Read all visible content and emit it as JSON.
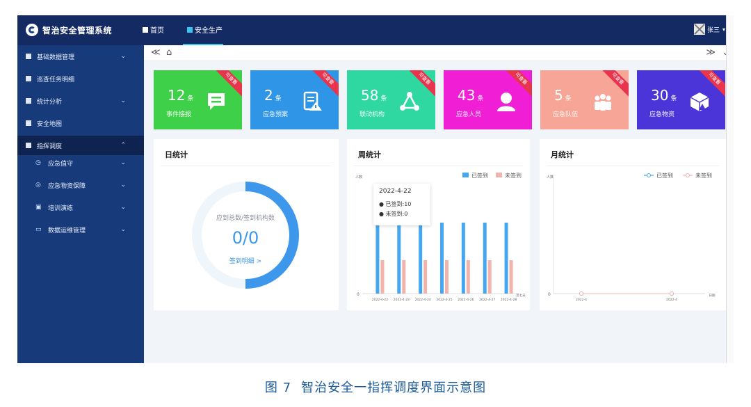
{
  "topbar": {
    "app_title": "智治安全管理系统",
    "tabs": [
      {
        "label": "首页"
      },
      {
        "label": "安全生产"
      }
    ],
    "user": "张三"
  },
  "sidebar": {
    "items": [
      {
        "label": "基础数据管理",
        "chevron": "⌄"
      },
      {
        "label": "巡查任务明细",
        "chevron": ""
      },
      {
        "label": "统计分析",
        "chevron": "⌄"
      },
      {
        "label": "安全地图",
        "chevron": ""
      },
      {
        "label": "指挥调度",
        "chevron": "⌃"
      }
    ],
    "sub_items": [
      {
        "label": "应急值守",
        "icon": "clock-icon",
        "glyph": "◷"
      },
      {
        "label": "应急物资保障",
        "icon": "layers-icon",
        "glyph": "◎"
      },
      {
        "label": "培训演练",
        "icon": "briefcase-icon",
        "glyph": "▣"
      },
      {
        "label": "数据运维管理",
        "icon": "monitor-icon",
        "glyph": "▭"
      }
    ]
  },
  "breadcrumb": {
    "collapse": "≪",
    "home": "⌂",
    "expand": "≫",
    "more": "⌄"
  },
  "cards": [
    {
      "value": "12",
      "unit": "条",
      "label": "事件接报",
      "badge": "可查看",
      "color": "#3fd04a",
      "icon": "message-icon"
    },
    {
      "value": "2",
      "unit": "条",
      "label": "应急预案",
      "badge": "可查看",
      "color": "#2f95e6",
      "icon": "document-alert-icon"
    },
    {
      "value": "58",
      "unit": "条",
      "label": "联动机构",
      "badge": "可查看",
      "color": "#2fd8a0",
      "icon": "network-icon"
    },
    {
      "value": "43",
      "unit": "条",
      "label": "应急人员",
      "badge": "可查看",
      "color": "#f01fd5",
      "icon": "person-icon"
    },
    {
      "value": "5",
      "unit": "条",
      "label": "应急队伍",
      "badge": "可查看",
      "color": "#f7a596",
      "icon": "team-icon"
    },
    {
      "value": "30",
      "unit": "条",
      "label": "应急物资",
      "badge": "可查看",
      "color": "#4b35d8",
      "icon": "box-icon"
    }
  ],
  "daily": {
    "title": "日统计",
    "ring_label": "应到总数/签到机构数",
    "ring_value": "0/0",
    "link": "签到明细 >"
  },
  "weekly": {
    "title": "周统计",
    "tooltip": {
      "date": "2022-4-22",
      "line1": "● 已签到:10",
      "line2": "● 未签到:0"
    }
  },
  "monthly": {
    "title": "月统计"
  },
  "chart_data": [
    {
      "type": "bar",
      "ylabel": "人数",
      "xlabel": "近七天",
      "categories": [
        "2022-4-22",
        "2022-4-23",
        "2022-4-24",
        "2022-4-25",
        "2022-4-26",
        "2022-4-27",
        "2022-4-28"
      ],
      "series": [
        {
          "name": "已签到",
          "color": "#45a7ef",
          "values": [
            10,
            10,
            10,
            10,
            10,
            10,
            10
          ]
        },
        {
          "name": "未签到",
          "color": "#f2b3ac",
          "values": [
            0,
            0,
            0,
            0,
            0,
            0,
            0
          ]
        }
      ],
      "ylim": [
        0,
        10
      ],
      "zero_label": "0"
    },
    {
      "type": "line",
      "ylabel": "人数",
      "xlabel": "日期",
      "categories": [
        "2022-4",
        "2022-4"
      ],
      "series": [
        {
          "name": "已签到",
          "color": "#45a7ef",
          "values": [
            0,
            0
          ]
        },
        {
          "name": "未签到",
          "color": "#f2b3ac",
          "values": [
            0,
            0
          ]
        }
      ],
      "zero_label": "0"
    }
  ],
  "caption": {
    "fig": "图 7",
    "text": "智治安全一指挥调度界面示意图"
  }
}
